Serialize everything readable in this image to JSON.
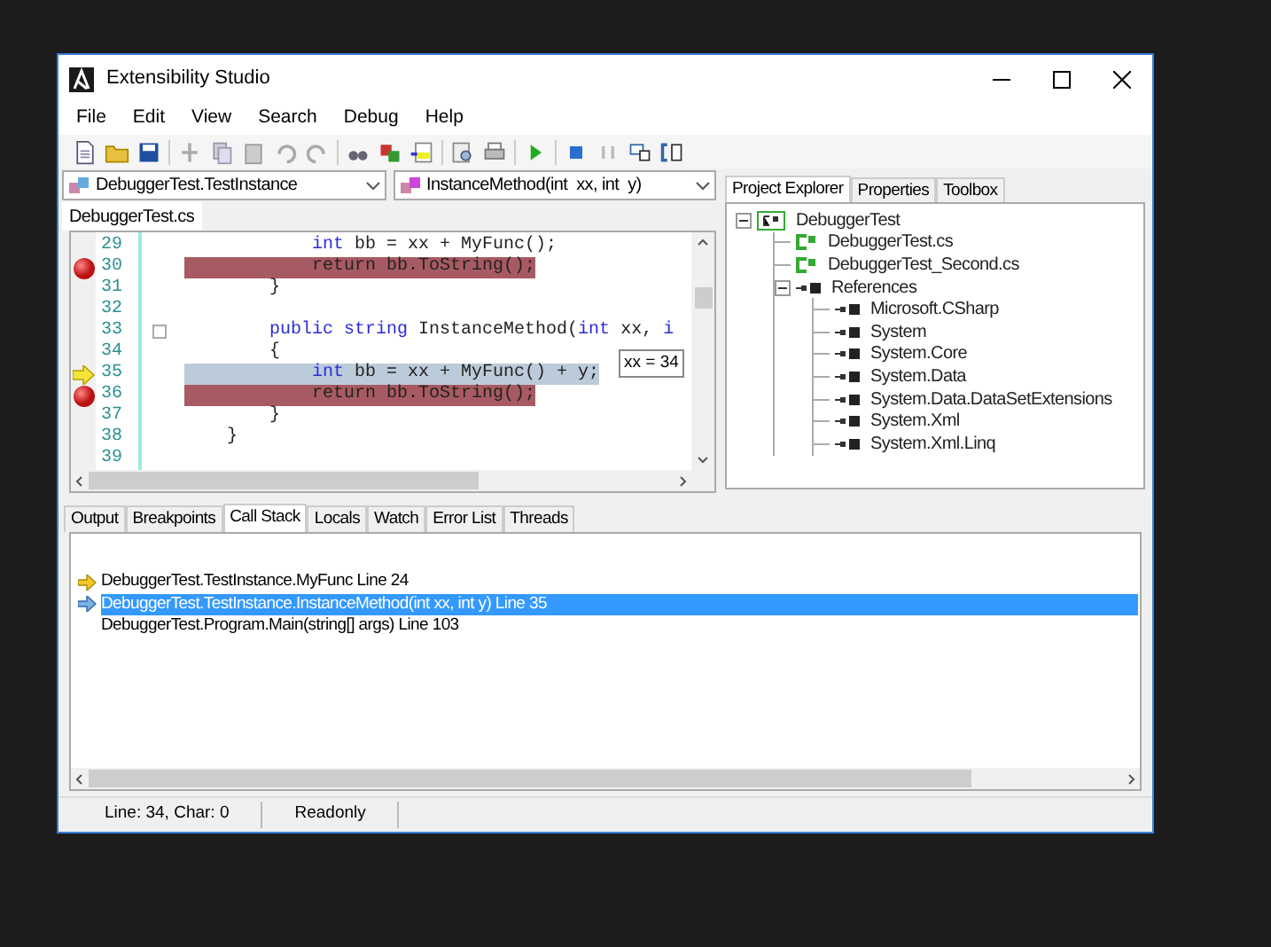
{
  "window": {
    "title": "Extensibility Studio"
  },
  "menu": [
    "File",
    "Edit",
    "View",
    "Search",
    "Debug",
    "Help"
  ],
  "class_selector": {
    "value": "DebuggerTest.TestInstance"
  },
  "method_selector": {
    "value": "InstanceMethod(int  xx, int  y)"
  },
  "editor_tabs": [
    {
      "label": "DebuggerTest.cs",
      "selected": true
    }
  ],
  "code_lines": [
    {
      "number": "29",
      "breakpoint": false,
      "current": false,
      "fold": false,
      "tokens": [
        {
          "text": "            int",
          "kind": "keyword"
        },
        {
          "text": " bb = xx + MyFunc();",
          "kind": "plain"
        }
      ]
    },
    {
      "number": "30",
      "breakpoint": true,
      "current": false,
      "fold": false,
      "tokens": [
        {
          "text": "            return bb.ToString();",
          "kind": "plain"
        }
      ]
    },
    {
      "number": "31",
      "breakpoint": false,
      "current": false,
      "fold": false,
      "tokens": [
        {
          "text": "        }",
          "kind": "plain"
        }
      ]
    },
    {
      "number": "32",
      "breakpoint": false,
      "current": false,
      "fold": false
    },
    {
      "number": "33",
      "breakpoint": false,
      "current": false,
      "fold": true,
      "tokens": [
        {
          "text": "        public string",
          "kind": "keyword"
        },
        {
          "text": " InstanceMethod(",
          "kind": "plain"
        },
        {
          "text": "int",
          "kind": "keyword"
        },
        {
          "text": " xx, ",
          "kind": "plain"
        },
        {
          "text": "i",
          "kind": "keyword"
        }
      ]
    },
    {
      "number": "34",
      "breakpoint": false,
      "current": false,
      "fold": false,
      "tokens": [
        {
          "text": "        {",
          "kind": "plain"
        }
      ]
    },
    {
      "number": "35",
      "breakpoint": false,
      "current": true,
      "fold": false,
      "tokens": [
        {
          "text": "            int",
          "kind": "keyword"
        },
        {
          "text": " bb = xx + MyFunc() + y;",
          "kind": "plain"
        }
      ]
    },
    {
      "number": "36",
      "breakpoint": true,
      "current": false,
      "fold": false,
      "tokens": [
        {
          "text": "            return bb.ToString();",
          "kind": "plain"
        }
      ]
    },
    {
      "number": "37",
      "breakpoint": false,
      "current": false,
      "fold": false,
      "tokens": [
        {
          "text": "        }",
          "kind": "plain"
        }
      ]
    },
    {
      "number": "38",
      "breakpoint": false,
      "current": false,
      "fold": false,
      "tokens": [
        {
          "text": "    }",
          "kind": "plain"
        }
      ]
    },
    {
      "number": "39",
      "breakpoint": false,
      "current": false,
      "fold": false
    }
  ],
  "tooltip": "xx = 34",
  "side_tabs": [
    {
      "label": "Project Explorer",
      "selected": true
    },
    {
      "label": "Properties",
      "selected": false
    },
    {
      "label": "Toolbox",
      "selected": false
    }
  ],
  "tree": [
    {
      "label": "DebuggerTest",
      "kind": "project",
      "expanded": true,
      "children": [
        {
          "label": "DebuggerTest.cs",
          "kind": "file"
        },
        {
          "label": "DebuggerTest_Second.cs",
          "kind": "file"
        },
        {
          "label": "References",
          "kind": "reference",
          "expanded": true,
          "children": [
            {
              "label": "Microsoft.CSharp",
              "kind": "reference"
            },
            {
              "label": "System",
              "kind": "reference"
            },
            {
              "label": "System.Core",
              "kind": "reference"
            },
            {
              "label": "System.Data",
              "kind": "reference"
            },
            {
              "label": "System.Data.DataSetExtensions",
              "kind": "reference"
            },
            {
              "label": "System.Xml",
              "kind": "reference"
            },
            {
              "label": "System.Xml.Linq",
              "kind": "reference"
            }
          ]
        }
      ]
    }
  ],
  "bottom_tabs": [
    {
      "label": "Output",
      "selected": false
    },
    {
      "label": "Breakpoints",
      "selected": false
    },
    {
      "label": "Call Stack",
      "selected": true
    },
    {
      "label": "Locals",
      "selected": false
    },
    {
      "label": "Watch",
      "selected": false
    },
    {
      "label": "Error List",
      "selected": false
    },
    {
      "label": "Threads",
      "selected": false
    }
  ],
  "call_stack": [
    {
      "text": "DebuggerTest.TestInstance.MyFunc Line 24",
      "current": true,
      "caller": false,
      "selected": false
    },
    {
      "text": "DebuggerTest.TestInstance.InstanceMethod(int xx, int y) Line 35",
      "current": false,
      "caller": true,
      "selected": true
    },
    {
      "text": "DebuggerTest.Program.Main(string[] args) Line 103",
      "current": false,
      "caller": false,
      "selected": false
    }
  ],
  "status_bar": [
    "Line: 34, Char: 0",
    "Readonly"
  ]
}
